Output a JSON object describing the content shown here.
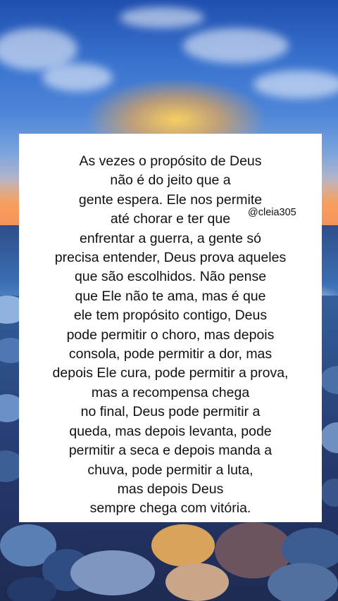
{
  "quote_lines": [
    "As vezes o propósito de Deus",
    "não é do jeito que a",
    "gente espera. Ele nos permite",
    "até chorar e ter que",
    "enfrentar a guerra, a gente só",
    "precisa entender, Deus prova aqueles",
    "que são escolhidos. Não pense",
    "que Ele não te ama, mas é que",
    "ele tem propósito contigo, Deus",
    "pode permitir o choro, mas depois",
    "consola, pode permitir a dor, mas",
    "depois Ele cura, pode permitir a prova,",
    "mas a recompensa chega",
    "no final, Deus pode permitir a",
    "queda, mas depois levanta, pode",
    "permitir a seca e depois manda a",
    "chuva, pode permitir a luta,",
    "mas depois Deus",
    "sempre chega com vitória."
  ],
  "watermark": "@cleia305",
  "colors": {
    "card_background": "#ffffff",
    "text": "#111111",
    "sky_top": "#1f4fb0",
    "sunset": "#f0a04a",
    "sea": "#3a6db2"
  },
  "background": {
    "scene": "beach-sunset",
    "icon": "beach-sunset-photo"
  }
}
